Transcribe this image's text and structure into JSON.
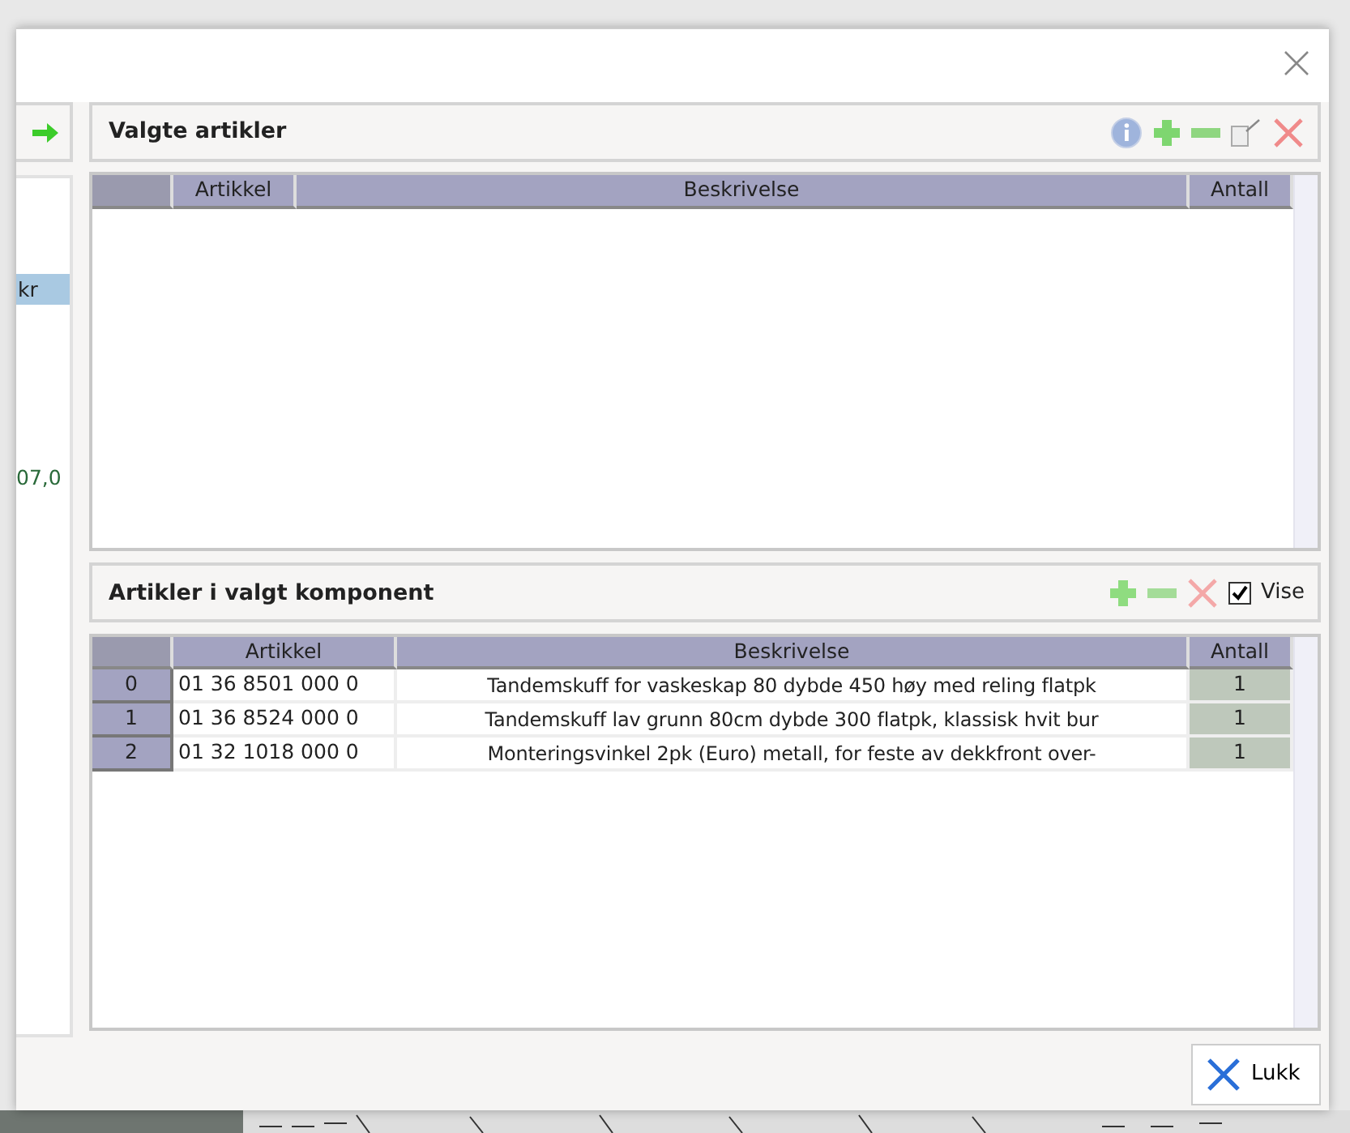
{
  "left_panel": {
    "selected_item": "kr",
    "amount": "07,0"
  },
  "selected_articles": {
    "title": "Valgte artikler",
    "columns": [
      "Artikkel",
      "Beskrivelse",
      "Antall"
    ]
  },
  "component_articles": {
    "title": "Artikler i valgt komponent",
    "show": {
      "label": "Vise",
      "checked": true
    },
    "columns": [
      "Artikkel",
      "Beskrivelse",
      "Antall"
    ],
    "rows": [
      {
        "index": "0",
        "article": "01 36 8501 000 0",
        "description": "Tandemskuff for vaskeskap 80 dybde 450 høy med reling flatpk",
        "quantity": "1"
      },
      {
        "index": "1",
        "article": "01 36 8524 000 0",
        "description": "Tandemskuff lav grunn 80cm dybde 300 flatpk, klassisk hvit bur",
        "quantity": "1"
      },
      {
        "index": "2",
        "article": "01 32 1018 000 0",
        "description": "Monteringsvinkel 2pk (Euro) metall, for feste av dekkfront over-",
        "quantity": "1"
      }
    ]
  },
  "footer": {
    "close_button": "Lukk"
  }
}
